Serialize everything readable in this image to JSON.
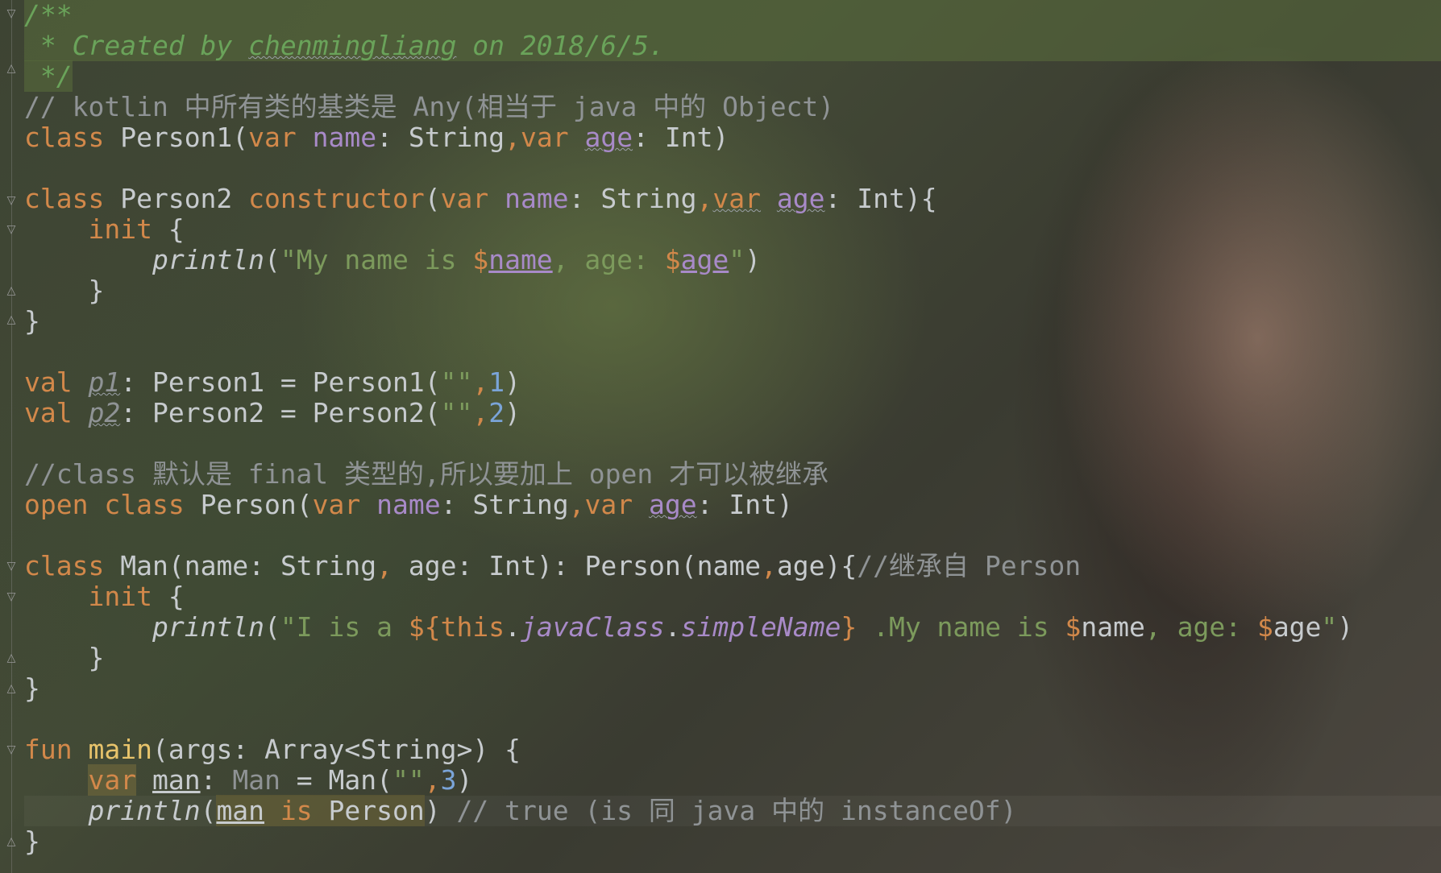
{
  "editor": {
    "lines": [
      "/**",
      " * Created by chenmingliang on 2018/6/5.",
      " */",
      "// kotlin 中所有类的基类是 Any(相当于 java 中的 Object)",
      "class Person1(var name: String,var age: Int)",
      "",
      "class Person2 constructor(var name: String,var age: Int){",
      "    init {",
      "        println(\"My name is $name, age: $age\")",
      "    }",
      "}",
      "",
      "val p1: Person1 = Person1(\"\",1)",
      "val p2: Person2 = Person2(\"\",2)",
      "",
      "//class 默认是 final 类型的,所以要加上 open 才可以被继承",
      "open class Person(var name: String,var age: Int)",
      "",
      "class Man(name: String, age: Int): Person(name,age){//继承自 Person",
      "    init {",
      "        println(\"I is a ${this.javaClass.simpleName} .My name is $name, age: $age\")",
      "    }",
      "}",
      "",
      "fun main(args: Array<String>) {",
      "    var man: Man = Man(\"\",3)",
      "    println(man is Person) // true (is 同 java 中的 instanceOf)",
      "}"
    ],
    "tokens": {
      "doc_open": "/**",
      "doc_prefix": " * ",
      "doc_created": "Created by ",
      "doc_author": "chenmingliang",
      "doc_date": " on 2018/6/5.",
      "doc_close": " */",
      "comment_any": "// kotlin 中所有类的基类是 Any(相当于 java 中的 Object)",
      "comment_final": "//class 默认是 final 类型的,所以要加上 open 才可以被继承",
      "comment_inherit": "//继承自 Person",
      "comment_instanceof": " // true (is 同 java 中的 instanceOf)",
      "kw_class": "class",
      "kw_var": "var",
      "kw_val": "val",
      "kw_open": "open",
      "kw_fun": "fun",
      "kw_constructor": "constructor",
      "kw_init": "init",
      "kw_this": "this",
      "kw_is": "is",
      "id_person1": "Person1",
      "id_person2": "Person2",
      "id_person": "Person",
      "id_man_class": "Man",
      "id_main": "main",
      "id_println": "println",
      "id_name": "name",
      "id_age": "age",
      "id_p1": "p1",
      "id_p2": "p2",
      "id_man": "man",
      "id_args": "args",
      "id_javaclass": "javaClass",
      "id_simplename": "simpleName",
      "type_string": "String",
      "type_int": "Int",
      "type_array_string": "Array<String>",
      "str_myname": "My name is ",
      "str_age": ", age: ",
      "str_iisa": "I is a ",
      "str_myname2": " .My name is ",
      "num_1": "1",
      "num_2": "2",
      "num_3": "3"
    }
  }
}
